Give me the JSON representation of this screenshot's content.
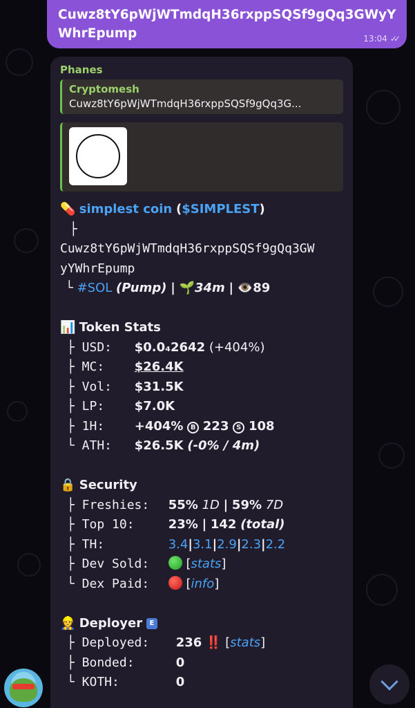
{
  "outgoing": {
    "text": "Cuwz8tY6pWjWTmdqH36rxppSQSf9gQq3GWyYWhrEpump",
    "time": "13:04",
    "status_icon": "double-check-icon"
  },
  "incoming": {
    "sender": "Phanes",
    "reply": {
      "title": "Cryptomesh",
      "text": "Cuwz8tY6pWjWTmdqH36rxppSQSf9gQq3G..."
    },
    "token": {
      "pill": "💊",
      "name": "simplest coin",
      "symbol": "$SIMPLEST",
      "tree_top": "├",
      "address_line1": "Cuwz8tY6pWjWTmdqH36rxppSQSf9gQq3GW",
      "address_line2": "yYWhrEpump",
      "tree_last": "└",
      "chain": "#SOL",
      "platform": "(Pump)",
      "sep": "|",
      "sprout": "🌱",
      "age": "34m",
      "eye": "👁️",
      "views": "89"
    },
    "stats": {
      "icon": "📊",
      "title": "Token Stats",
      "usd_label": "├ USD:",
      "usd_value": "$0.0₄2642",
      "usd_change": "(+404%)",
      "mc_label": "├ MC:",
      "mc_value": "$26.4K",
      "vol_label": "├ Vol:",
      "vol_value": "$31.5K",
      "lp_label": "├ LP:",
      "lp_value": "$7.0K",
      "h1_label": "├ 1H:",
      "h1_change": "+404%",
      "h1_b": "B",
      "h1_buys": "223",
      "h1_s": "S",
      "h1_sells": "108",
      "ath_label": "└ ATH:",
      "ath_value": "$26.5K",
      "ath_change": "(-0% / 4m)"
    },
    "security": {
      "icon": "🔒",
      "title": "Security",
      "fresh_label": "├ Freshies:",
      "fresh_1d": "55%",
      "fresh_1d_tag": "1D",
      "fresh_sep": "|",
      "fresh_7d": "59%",
      "fresh_7d_tag": "7D",
      "top10_label": "├ Top 10:",
      "top10_pct": "23%",
      "top10_sep": "|",
      "top10_count": "142",
      "top10_total": "(total)",
      "th_label": "├ TH:",
      "th_values": [
        "3.4",
        "3.1",
        "2.9",
        "2.3",
        "2.2"
      ],
      "th_sep": "|",
      "devsold_label": "├ Dev Sold:",
      "devsold_status": "green",
      "devsold_link": "stats",
      "dexpaid_label": "└ Dex Paid:",
      "dexpaid_status": "red",
      "dexpaid_link": "info",
      "bracket_open": "[",
      "bracket_close": "]"
    },
    "deployer": {
      "icon": "👷",
      "title": "Deployer",
      "badge": "E",
      "deployed_label": "├ Deployed:",
      "deployed_value": "236",
      "deployed_alert": "‼️",
      "deployed_link": "stats",
      "bonded_label": "├ Bonded:",
      "bonded_value": "0",
      "koth_label": "└ KOTH:",
      "koth_value": "0"
    }
  },
  "avatar_icon": "pepe-avatar-icon",
  "scroll_icon": "chevron-down-icon",
  "colors": {
    "outgoing_bubble": "#8a52d6",
    "incoming_bubble": "#211c2c",
    "link": "#4aa3f5",
    "sender": "#9bd06b"
  }
}
